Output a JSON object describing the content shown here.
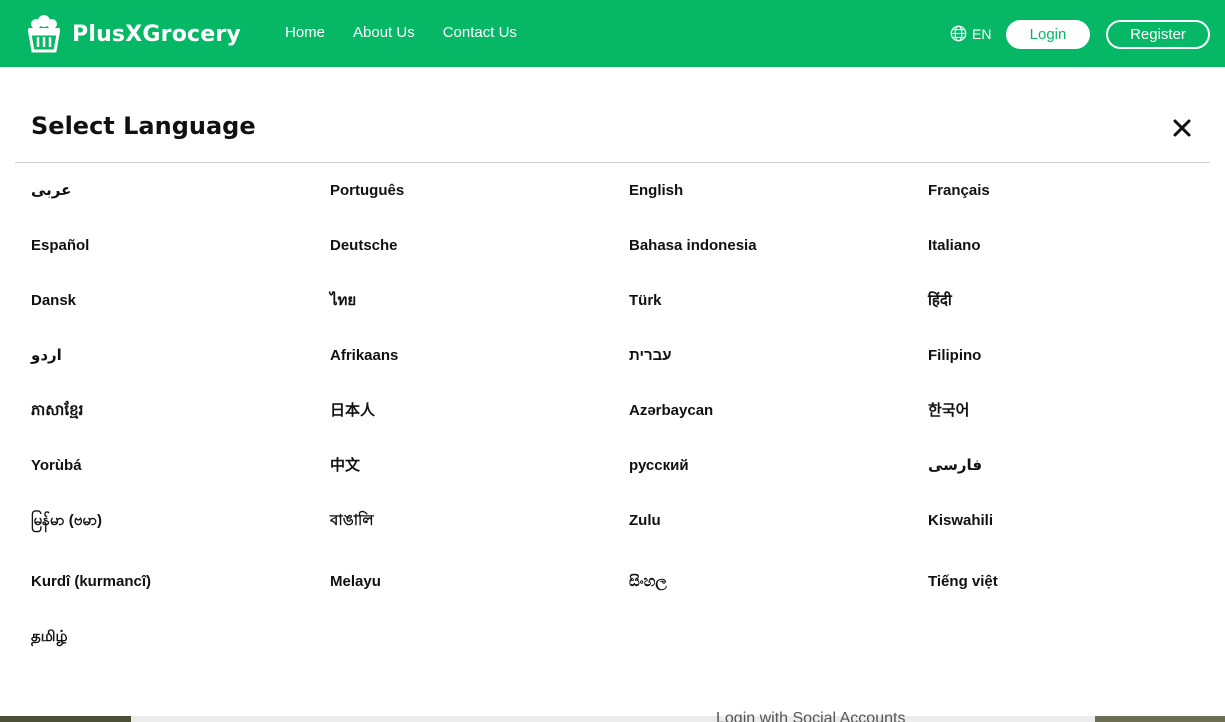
{
  "brand": {
    "name": "PlusXGrocery"
  },
  "nav": {
    "items": [
      "Home",
      "About Us",
      "Contact Us"
    ]
  },
  "header": {
    "language_code": "EN",
    "login_label": "Login",
    "register_label": "Register"
  },
  "modal": {
    "title": "Select Language"
  },
  "languages": [
    "عربى",
    "Português",
    "English",
    "Français",
    "Español",
    "Deutsche",
    "Bahasa indonesia",
    "Italiano",
    "Dansk",
    "ไทย",
    "Türk",
    "हिंदी",
    "اردو",
    "Afrikaans",
    "עברית",
    "Filipino",
    "ភាសាខ្មែរ",
    "日本人",
    "Azərbaycan",
    "한국어",
    "Yorùbá",
    "中文",
    "русский",
    "فارسی",
    "မြန်မာ (ဗမာ)",
    "বাঙালি",
    "Zulu",
    "Kiswahili",
    "Kurdî (kurmancî)",
    "Melayu",
    "සිංහල",
    "Tiếng việt",
    "தமிழ்"
  ],
  "background": {
    "social_text": "Login with Social Accounts"
  },
  "colors": {
    "brand_green": "#06b866",
    "text": "#111111",
    "divider": "#cfcfcf"
  }
}
